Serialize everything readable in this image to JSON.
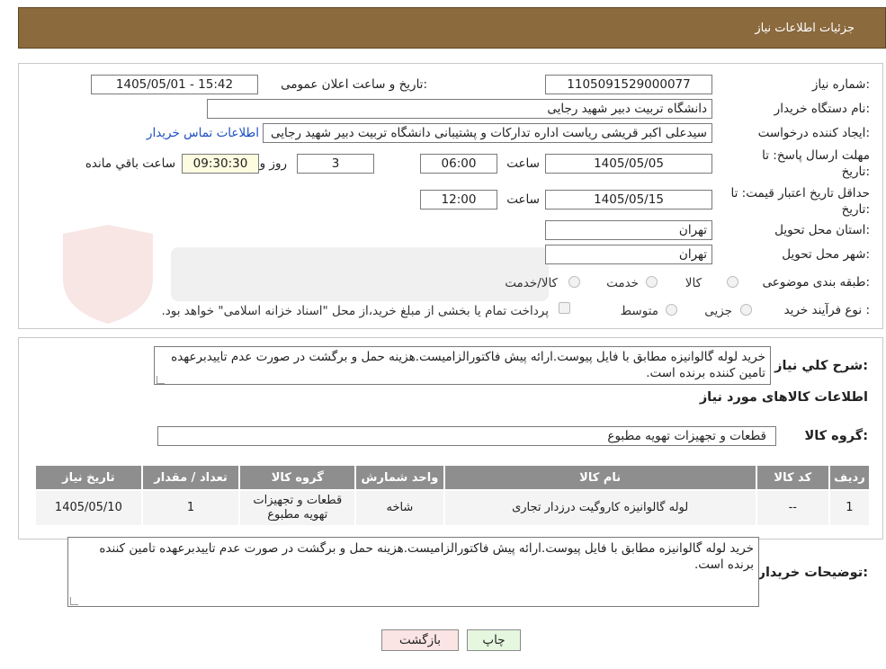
{
  "header": {
    "title": "جزئیات اطلاعات نیاز"
  },
  "form": {
    "need_number_label": "شماره نیاز:",
    "need_number": "1105091529000077",
    "announce_label": "تاریخ و ساعت اعلان عمومی:",
    "announce_value": "1405/05/01 - 15:42",
    "buyer_org_label": "نام دستگاه خریدار:",
    "buyer_org": "دانشگاه تربیت دبیر شهید رجایی",
    "requester_label": "ایجاد کننده درخواست:",
    "requester": "سیدعلی اکبر قریشی ریاست اداره تدارکات و پشتیبانی دانشگاه تربیت دبیر شهید رجایی",
    "contact_link": "اطلاعات تماس خریدار",
    "deadline_label": "مهلت ارسال پاسخ: تا تاریخ:",
    "deadline_date": "1405/05/05",
    "time_label": "ساعت",
    "deadline_time": "06:00",
    "days_value": "3",
    "days_label": "روز و",
    "remaining_time": "09:30:30",
    "remaining_label": "ساعت باقي مانده",
    "validity_label": "حداقل تاریخ اعتبار قیمت: تا تاریخ:",
    "validity_date": "1405/05/15",
    "validity_time": "12:00",
    "province_label": "استان محل تحویل:",
    "province": "تهران",
    "city_label": "شهر محل تحویل:",
    "city": "تهران",
    "category_label": "طبقه بندی موضوعی:",
    "category_options": [
      "کالا",
      "خدمت",
      "کالا/خدمت"
    ],
    "process_label": "نوع فرآیند خرید :",
    "process_options": [
      "جزیی",
      "متوسط"
    ],
    "payment_note": "پرداخت تمام یا بخشی از مبلغ خرید،از محل \"اسناد خزانه اسلامی\" خواهد بود."
  },
  "summary": {
    "label": "شرح كلي نياز:",
    "text": "خرید لوله گالوانیزه مطابق با فایل پیوست.ارائه پیش فاکتورالزامیست.هزینه حمل و برگشت در صورت عدم تاییدبرعهده تامین کننده برنده است."
  },
  "goods": {
    "section_title": "اطلاعات کالاهای مورد نیاز",
    "group_label": "گروه کالا:",
    "group_value": "قطعات و تجهیزات تهویه مطبوع",
    "columns": [
      "ردیف",
      "کد کالا",
      "نام کالا",
      "واحد شمارش",
      "گروه کالا",
      "تعداد / مقدار",
      "تاریخ نیاز"
    ],
    "rows": [
      {
        "index": "1",
        "code": "--",
        "name": "لوله گالوانیزه کاروگیت درزدار تجاری",
        "unit": "شاخه",
        "group": "قطعات و تجهیزات تهویه مطبوع",
        "qty": "1",
        "date": "1405/05/10"
      }
    ]
  },
  "buyer_notes": {
    "label": "توضیحات خریدار:",
    "text": "خرید لوله گالوانیزه مطابق با فایل پیوست.ارائه پیش فاکتورالزامیست.هزینه حمل و برگشت در صورت عدم تاییدبرعهده تامین کننده برنده است."
  },
  "buttons": {
    "print": "چاپ",
    "back": "بازگشت"
  },
  "colors": {
    "header_bg": "#8b6a3e",
    "table_header": "#8e8e8e",
    "link": "#1a4fc2",
    "print_bg": "#e6f7e0",
    "back_bg": "#fbe4e4"
  }
}
